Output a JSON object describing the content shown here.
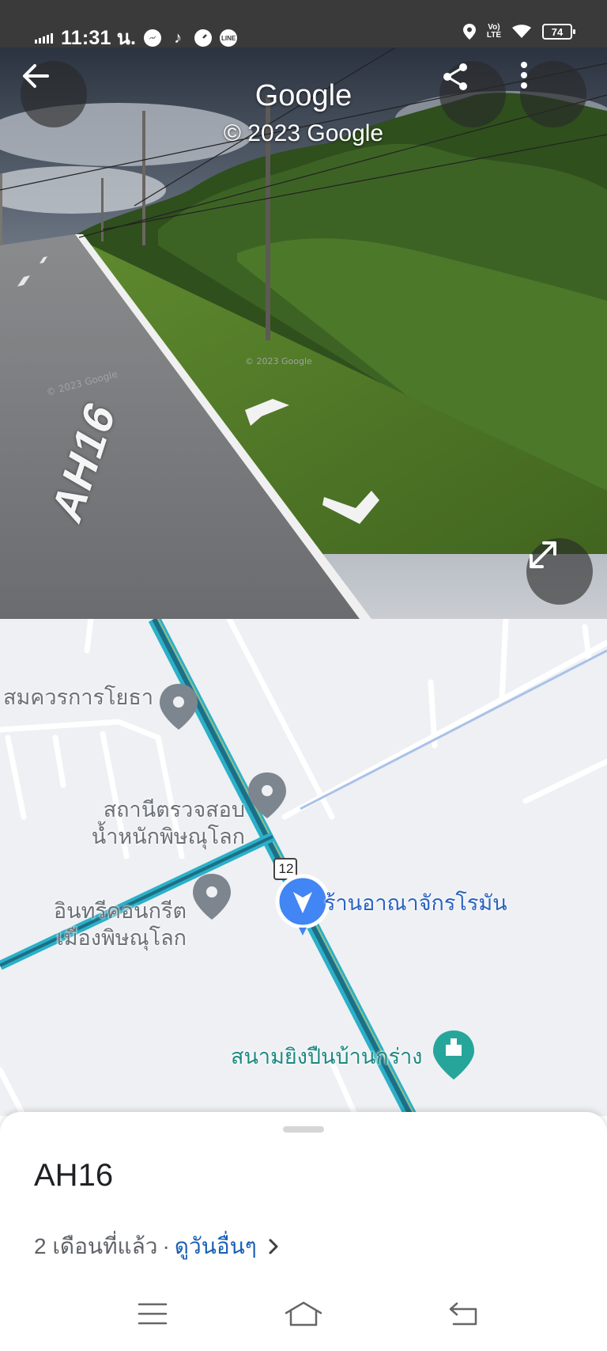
{
  "status_bar": {
    "time": "11:31 น.",
    "battery": "74",
    "network": "LTE"
  },
  "street_view": {
    "title": "Google",
    "copyright": "© 2023 Google",
    "road_marking": "AH16",
    "watermark": "© 2023 Google"
  },
  "map": {
    "route_shield": "12",
    "pois": [
      {
        "label": "สมควรการโยธา",
        "icon": "map-pin-icon"
      },
      {
        "label": "สถานีตรวจสอบ\nน้ำหนักพิษณุโลก",
        "icon": "map-pin-icon"
      },
      {
        "label": "อินทรีคอนกรีต\nเมืองพิษณุโลก",
        "icon": "map-pin-icon"
      },
      {
        "label": "ร้านอาณาจักรโรมัน",
        "icon": "none"
      },
      {
        "label": "สนามยิงปืนบ้านกร่าง",
        "icon": "landmark-pin-icon"
      }
    ]
  },
  "sheet": {
    "title": "AH16",
    "date_text": "2 เดือนที่แล้ว",
    "separator": "·",
    "more_dates_link": "ดูวันอื่นๆ"
  },
  "colors": {
    "status_bar": "#3a3a3a",
    "map_bg": "#eef0f3",
    "highway_teal": "#2bb0c8",
    "location_blue": "#4285f4",
    "link_blue": "#1a5fb4"
  }
}
